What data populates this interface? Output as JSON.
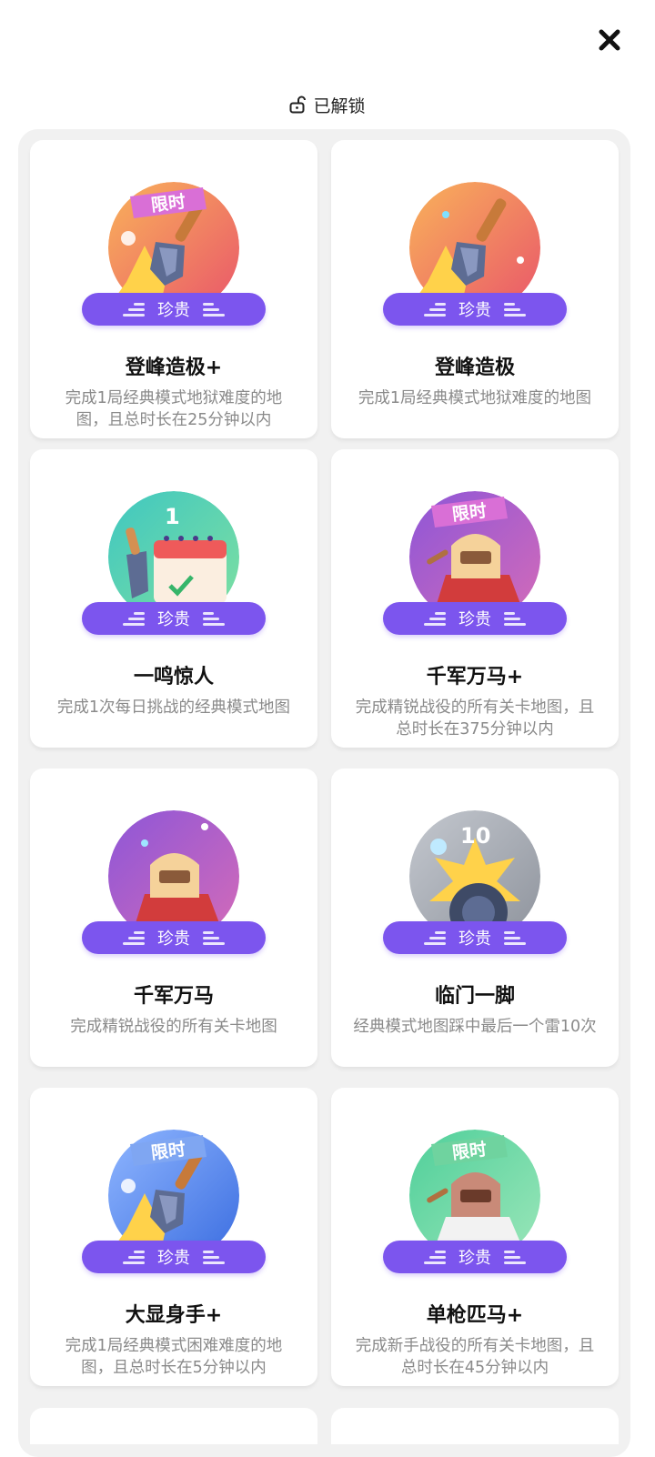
{
  "header": {
    "title": "已解锁"
  },
  "achievements": [
    {
      "title": "登峰造极+",
      "desc": "完成1局经典模式地狱难度的地图，且总时长在25分钟以内",
      "rarity": "珍贵",
      "limited_label": "限时",
      "theme": "#f08a5e"
    },
    {
      "title": "登峰造极",
      "desc": "完成1局经典模式地狱难度的地图",
      "rarity": "珍贵",
      "limited_label": "",
      "theme": "#f08a5e"
    },
    {
      "title": "一鸣惊人",
      "desc": "完成1次每日挑战的经典模式地图",
      "rarity": "珍贵",
      "limited_label": "",
      "badge_number": "1",
      "theme": "#56cfb5"
    },
    {
      "title": "千军万马+",
      "desc": "完成精锐战役的所有关卡地图，且总时长在375分钟以内",
      "rarity": "珍贵",
      "limited_label": "限时",
      "theme": "#b25ad6"
    },
    {
      "title": "千军万马",
      "desc": "完成精锐战役的所有关卡地图",
      "rarity": "珍贵",
      "limited_label": "",
      "theme": "#b25ad6"
    },
    {
      "title": "临门一脚",
      "desc": "经典模式地图踩中最后一个雷10次",
      "rarity": "珍贵",
      "limited_label": "",
      "badge_number": "10",
      "theme": "#b9bcc2"
    },
    {
      "title": "大显身手+",
      "desc": "完成1局经典模式困难难度的地图，且总时长在5分钟以内",
      "rarity": "珍贵",
      "limited_label": "限时",
      "theme": "#5a8cf0"
    },
    {
      "title": "单枪匹马+",
      "desc": "完成新手战役的所有关卡地图，且总时长在45分钟以内",
      "rarity": "珍贵",
      "limited_label": "限时",
      "theme": "#5ed6a6"
    }
  ]
}
